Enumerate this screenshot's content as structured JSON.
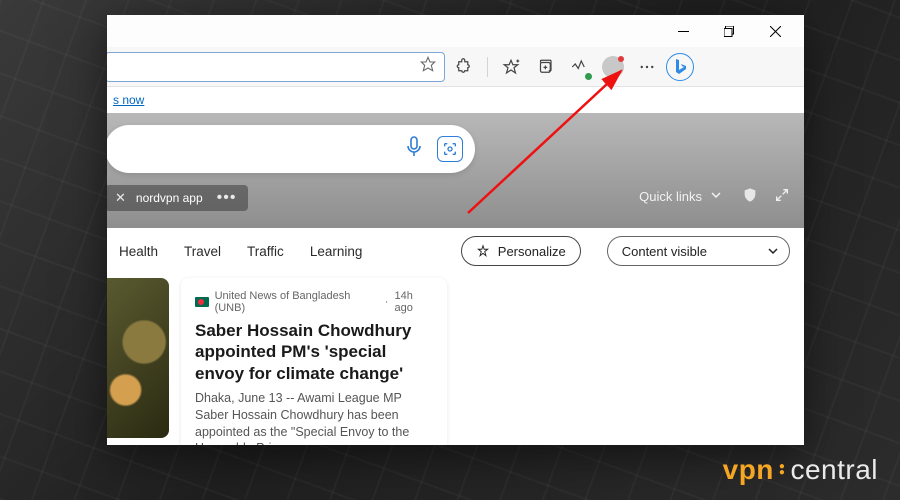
{
  "link_text": "s now",
  "hero_chip": "nordvpn app",
  "quick_links_label": "Quick links",
  "feed_tabs": [
    "Health",
    "Travel",
    "Traffic",
    "Learning"
  ],
  "personalize_label": "Personalize",
  "content_visible_label": "Content visible",
  "card": {
    "source": "United News of Bangladesh (UNB)",
    "time": "14h ago",
    "title": "Saber Hossain Chowdhury appointed PM's 'special envoy for climate change'",
    "body": "Dhaka, June 13 -- Awami League MP Saber Hossain Chowdhury has been appointed as the \"Special Envoy to the Honorable Prim…"
  },
  "watermark": {
    "a": "vpn",
    "b": "central"
  }
}
